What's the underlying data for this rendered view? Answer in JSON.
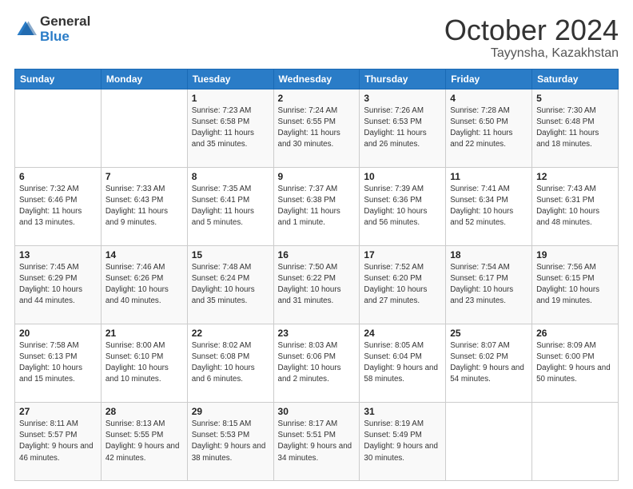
{
  "logo": {
    "general": "General",
    "blue": "Blue"
  },
  "header": {
    "month": "October 2024",
    "location": "Tayynsha, Kazakhstan"
  },
  "weekdays": [
    "Sunday",
    "Monday",
    "Tuesday",
    "Wednesday",
    "Thursday",
    "Friday",
    "Saturday"
  ],
  "weeks": [
    [
      null,
      null,
      {
        "day": 1,
        "sunrise": "7:23 AM",
        "sunset": "6:58 PM",
        "daylight": "11 hours and 35 minutes."
      },
      {
        "day": 2,
        "sunrise": "7:24 AM",
        "sunset": "6:55 PM",
        "daylight": "11 hours and 30 minutes."
      },
      {
        "day": 3,
        "sunrise": "7:26 AM",
        "sunset": "6:53 PM",
        "daylight": "11 hours and 26 minutes."
      },
      {
        "day": 4,
        "sunrise": "7:28 AM",
        "sunset": "6:50 PM",
        "daylight": "11 hours and 22 minutes."
      },
      {
        "day": 5,
        "sunrise": "7:30 AM",
        "sunset": "6:48 PM",
        "daylight": "11 hours and 18 minutes."
      }
    ],
    [
      {
        "day": 6,
        "sunrise": "7:32 AM",
        "sunset": "6:46 PM",
        "daylight": "11 hours and 13 minutes."
      },
      {
        "day": 7,
        "sunrise": "7:33 AM",
        "sunset": "6:43 PM",
        "daylight": "11 hours and 9 minutes."
      },
      {
        "day": 8,
        "sunrise": "7:35 AM",
        "sunset": "6:41 PM",
        "daylight": "11 hours and 5 minutes."
      },
      {
        "day": 9,
        "sunrise": "7:37 AM",
        "sunset": "6:38 PM",
        "daylight": "11 hours and 1 minute."
      },
      {
        "day": 10,
        "sunrise": "7:39 AM",
        "sunset": "6:36 PM",
        "daylight": "10 hours and 56 minutes."
      },
      {
        "day": 11,
        "sunrise": "7:41 AM",
        "sunset": "6:34 PM",
        "daylight": "10 hours and 52 minutes."
      },
      {
        "day": 12,
        "sunrise": "7:43 AM",
        "sunset": "6:31 PM",
        "daylight": "10 hours and 48 minutes."
      }
    ],
    [
      {
        "day": 13,
        "sunrise": "7:45 AM",
        "sunset": "6:29 PM",
        "daylight": "10 hours and 44 minutes."
      },
      {
        "day": 14,
        "sunrise": "7:46 AM",
        "sunset": "6:26 PM",
        "daylight": "10 hours and 40 minutes."
      },
      {
        "day": 15,
        "sunrise": "7:48 AM",
        "sunset": "6:24 PM",
        "daylight": "10 hours and 35 minutes."
      },
      {
        "day": 16,
        "sunrise": "7:50 AM",
        "sunset": "6:22 PM",
        "daylight": "10 hours and 31 minutes."
      },
      {
        "day": 17,
        "sunrise": "7:52 AM",
        "sunset": "6:20 PM",
        "daylight": "10 hours and 27 minutes."
      },
      {
        "day": 18,
        "sunrise": "7:54 AM",
        "sunset": "6:17 PM",
        "daylight": "10 hours and 23 minutes."
      },
      {
        "day": 19,
        "sunrise": "7:56 AM",
        "sunset": "6:15 PM",
        "daylight": "10 hours and 19 minutes."
      }
    ],
    [
      {
        "day": 20,
        "sunrise": "7:58 AM",
        "sunset": "6:13 PM",
        "daylight": "10 hours and 15 minutes."
      },
      {
        "day": 21,
        "sunrise": "8:00 AM",
        "sunset": "6:10 PM",
        "daylight": "10 hours and 10 minutes."
      },
      {
        "day": 22,
        "sunrise": "8:02 AM",
        "sunset": "6:08 PM",
        "daylight": "10 hours and 6 minutes."
      },
      {
        "day": 23,
        "sunrise": "8:03 AM",
        "sunset": "6:06 PM",
        "daylight": "10 hours and 2 minutes."
      },
      {
        "day": 24,
        "sunrise": "8:05 AM",
        "sunset": "6:04 PM",
        "daylight": "9 hours and 58 minutes."
      },
      {
        "day": 25,
        "sunrise": "8:07 AM",
        "sunset": "6:02 PM",
        "daylight": "9 hours and 54 minutes."
      },
      {
        "day": 26,
        "sunrise": "8:09 AM",
        "sunset": "6:00 PM",
        "daylight": "9 hours and 50 minutes."
      }
    ],
    [
      {
        "day": 27,
        "sunrise": "8:11 AM",
        "sunset": "5:57 PM",
        "daylight": "9 hours and 46 minutes."
      },
      {
        "day": 28,
        "sunrise": "8:13 AM",
        "sunset": "5:55 PM",
        "daylight": "9 hours and 42 minutes."
      },
      {
        "day": 29,
        "sunrise": "8:15 AM",
        "sunset": "5:53 PM",
        "daylight": "9 hours and 38 minutes."
      },
      {
        "day": 30,
        "sunrise": "8:17 AM",
        "sunset": "5:51 PM",
        "daylight": "9 hours and 34 minutes."
      },
      {
        "day": 31,
        "sunrise": "8:19 AM",
        "sunset": "5:49 PM",
        "daylight": "9 hours and 30 minutes."
      },
      null,
      null
    ]
  ],
  "labels": {
    "sunrise": "Sunrise:",
    "sunset": "Sunset:",
    "daylight": "Daylight:"
  }
}
